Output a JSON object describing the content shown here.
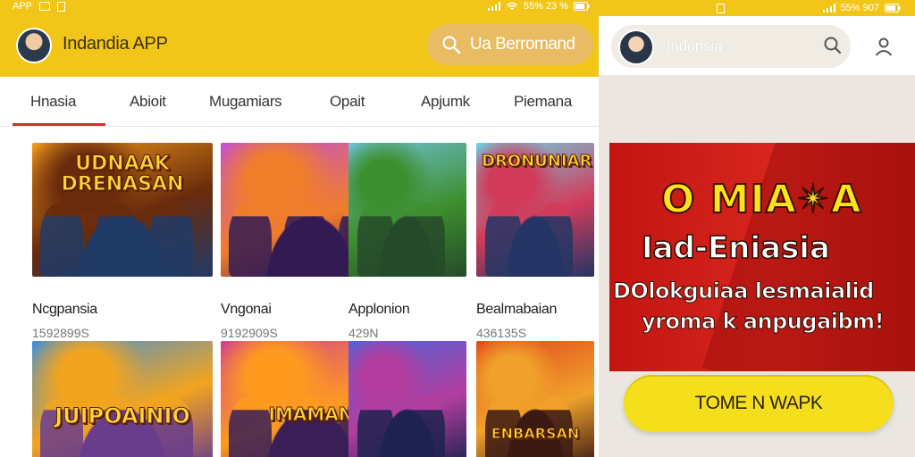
{
  "left": {
    "status": {
      "left_text": "APP",
      "right_text": "55% 23 %"
    },
    "app_bar": {
      "title": "Indandia APP",
      "search_label": "Ua Berromand"
    },
    "tabs": [
      {
        "label": "Hnasia",
        "active": true
      },
      {
        "label": "Abioit",
        "active": false
      },
      {
        "label": "Mugamiars",
        "active": false
      },
      {
        "label": "Opait",
        "active": false
      },
      {
        "label": "Apjumk",
        "active": false
      },
      {
        "label": "Piemana",
        "active": false
      }
    ],
    "games": [
      {
        "name": "Ncgpansia",
        "count": "1592899S",
        "logo": "UDNAAK DRENASAN",
        "colors": [
          "#f39a1a",
          "#6a2b0c",
          "#203a66"
        ]
      },
      {
        "name": "Vngonai",
        "count": "9192909S",
        "logo": "",
        "colors": [
          "#c44ed6",
          "#f07d2a",
          "#341a53"
        ]
      },
      {
        "name": "Applonion",
        "count": "429N",
        "logo": "",
        "colors": [
          "#6fc1d7",
          "#3e8f2f",
          "#254a2a"
        ]
      },
      {
        "name": "Bealmabaian",
        "count": "436135S",
        "logo": "DRONUNIAR",
        "colors": [
          "#6ed2e6",
          "#d23b5a",
          "#243565"
        ]
      },
      {
        "name": "",
        "count": "",
        "logo": "JUIPOAINIO",
        "colors": [
          "#3c8fe0",
          "#f2a41f",
          "#6a3c8c"
        ]
      },
      {
        "name": "",
        "count": "",
        "logo": "IMAMAN",
        "colors": [
          "#d04090",
          "#ff9a1f",
          "#3a1f56"
        ]
      },
      {
        "name": "",
        "count": "",
        "logo": "",
        "colors": [
          "#4c64d8",
          "#b33ea0",
          "#1e2250"
        ]
      },
      {
        "name": "",
        "count": "",
        "logo": "ENBARSAN",
        "colors": [
          "#e1481e",
          "#f0a12b",
          "#3b1a14"
        ]
      }
    ]
  },
  "right": {
    "status": {
      "right_text": "55% 907"
    },
    "header": {
      "search_text": "Indonsia"
    },
    "promo": {
      "headline": "O MIA✴A",
      "title": "Iad-Eniasia",
      "line1": "DOlokguiaa lesmaialid",
      "line2": "yroma k anpugaibm!"
    },
    "cta_label": "TOME N WAPK"
  },
  "colors": {
    "yellow": "#f2c618",
    "red": "#c21512",
    "tab_underline": "#d32f2f",
    "cta": "#f5df1c"
  },
  "icons": [
    "search-icon",
    "user-icon",
    "wifi-icon",
    "battery-icon",
    "signal-icon"
  ]
}
